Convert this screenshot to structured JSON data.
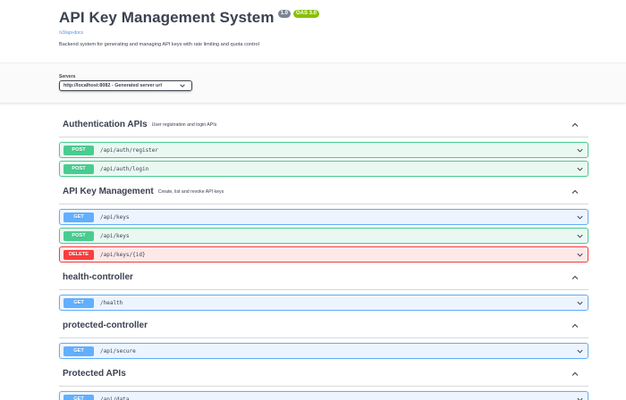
{
  "info": {
    "title": "API Key Management System",
    "version_badge": "1.0",
    "oas_badge": "OAS 3.0",
    "docs_link": "/v3/api-docs",
    "description": "Backend system for generating and managing API keys with rate limiting and quota control"
  },
  "servers": {
    "label": "Servers",
    "selected": "http://localhost:8082 - Generated server url"
  },
  "tags": [
    {
      "name": "Authentication APIs",
      "description": "User registration and login APIs",
      "operations": [
        {
          "method": "POST",
          "path": "/api/auth/register"
        },
        {
          "method": "POST",
          "path": "/api/auth/login"
        }
      ]
    },
    {
      "name": "API Key Management",
      "description": "Create, list and revoke API keys",
      "operations": [
        {
          "method": "GET",
          "path": "/api/keys"
        },
        {
          "method": "POST",
          "path": "/api/keys"
        },
        {
          "method": "DELETE",
          "path": "/api/keys/{id}"
        }
      ]
    },
    {
      "name": "health-controller",
      "description": "",
      "operations": [
        {
          "method": "GET",
          "path": "/health"
        }
      ]
    },
    {
      "name": "protected-controller",
      "description": "",
      "operations": [
        {
          "method": "GET",
          "path": "/api/secure"
        }
      ]
    },
    {
      "name": "Protected APIs",
      "description": "",
      "operations": [
        {
          "method": "GET",
          "path": "/api/data"
        }
      ]
    }
  ],
  "colors": {
    "post": "#49cc90",
    "get": "#61affe",
    "delete": "#f93e3e",
    "oas_badge": "#89bf04",
    "version_badge": "#7d8492",
    "link": "#4990e2"
  },
  "icons": {
    "tag_toggle": "chevron-up-icon",
    "operation_toggle": "chevron-down-icon",
    "select_arrow": "chevron-down-icon"
  }
}
